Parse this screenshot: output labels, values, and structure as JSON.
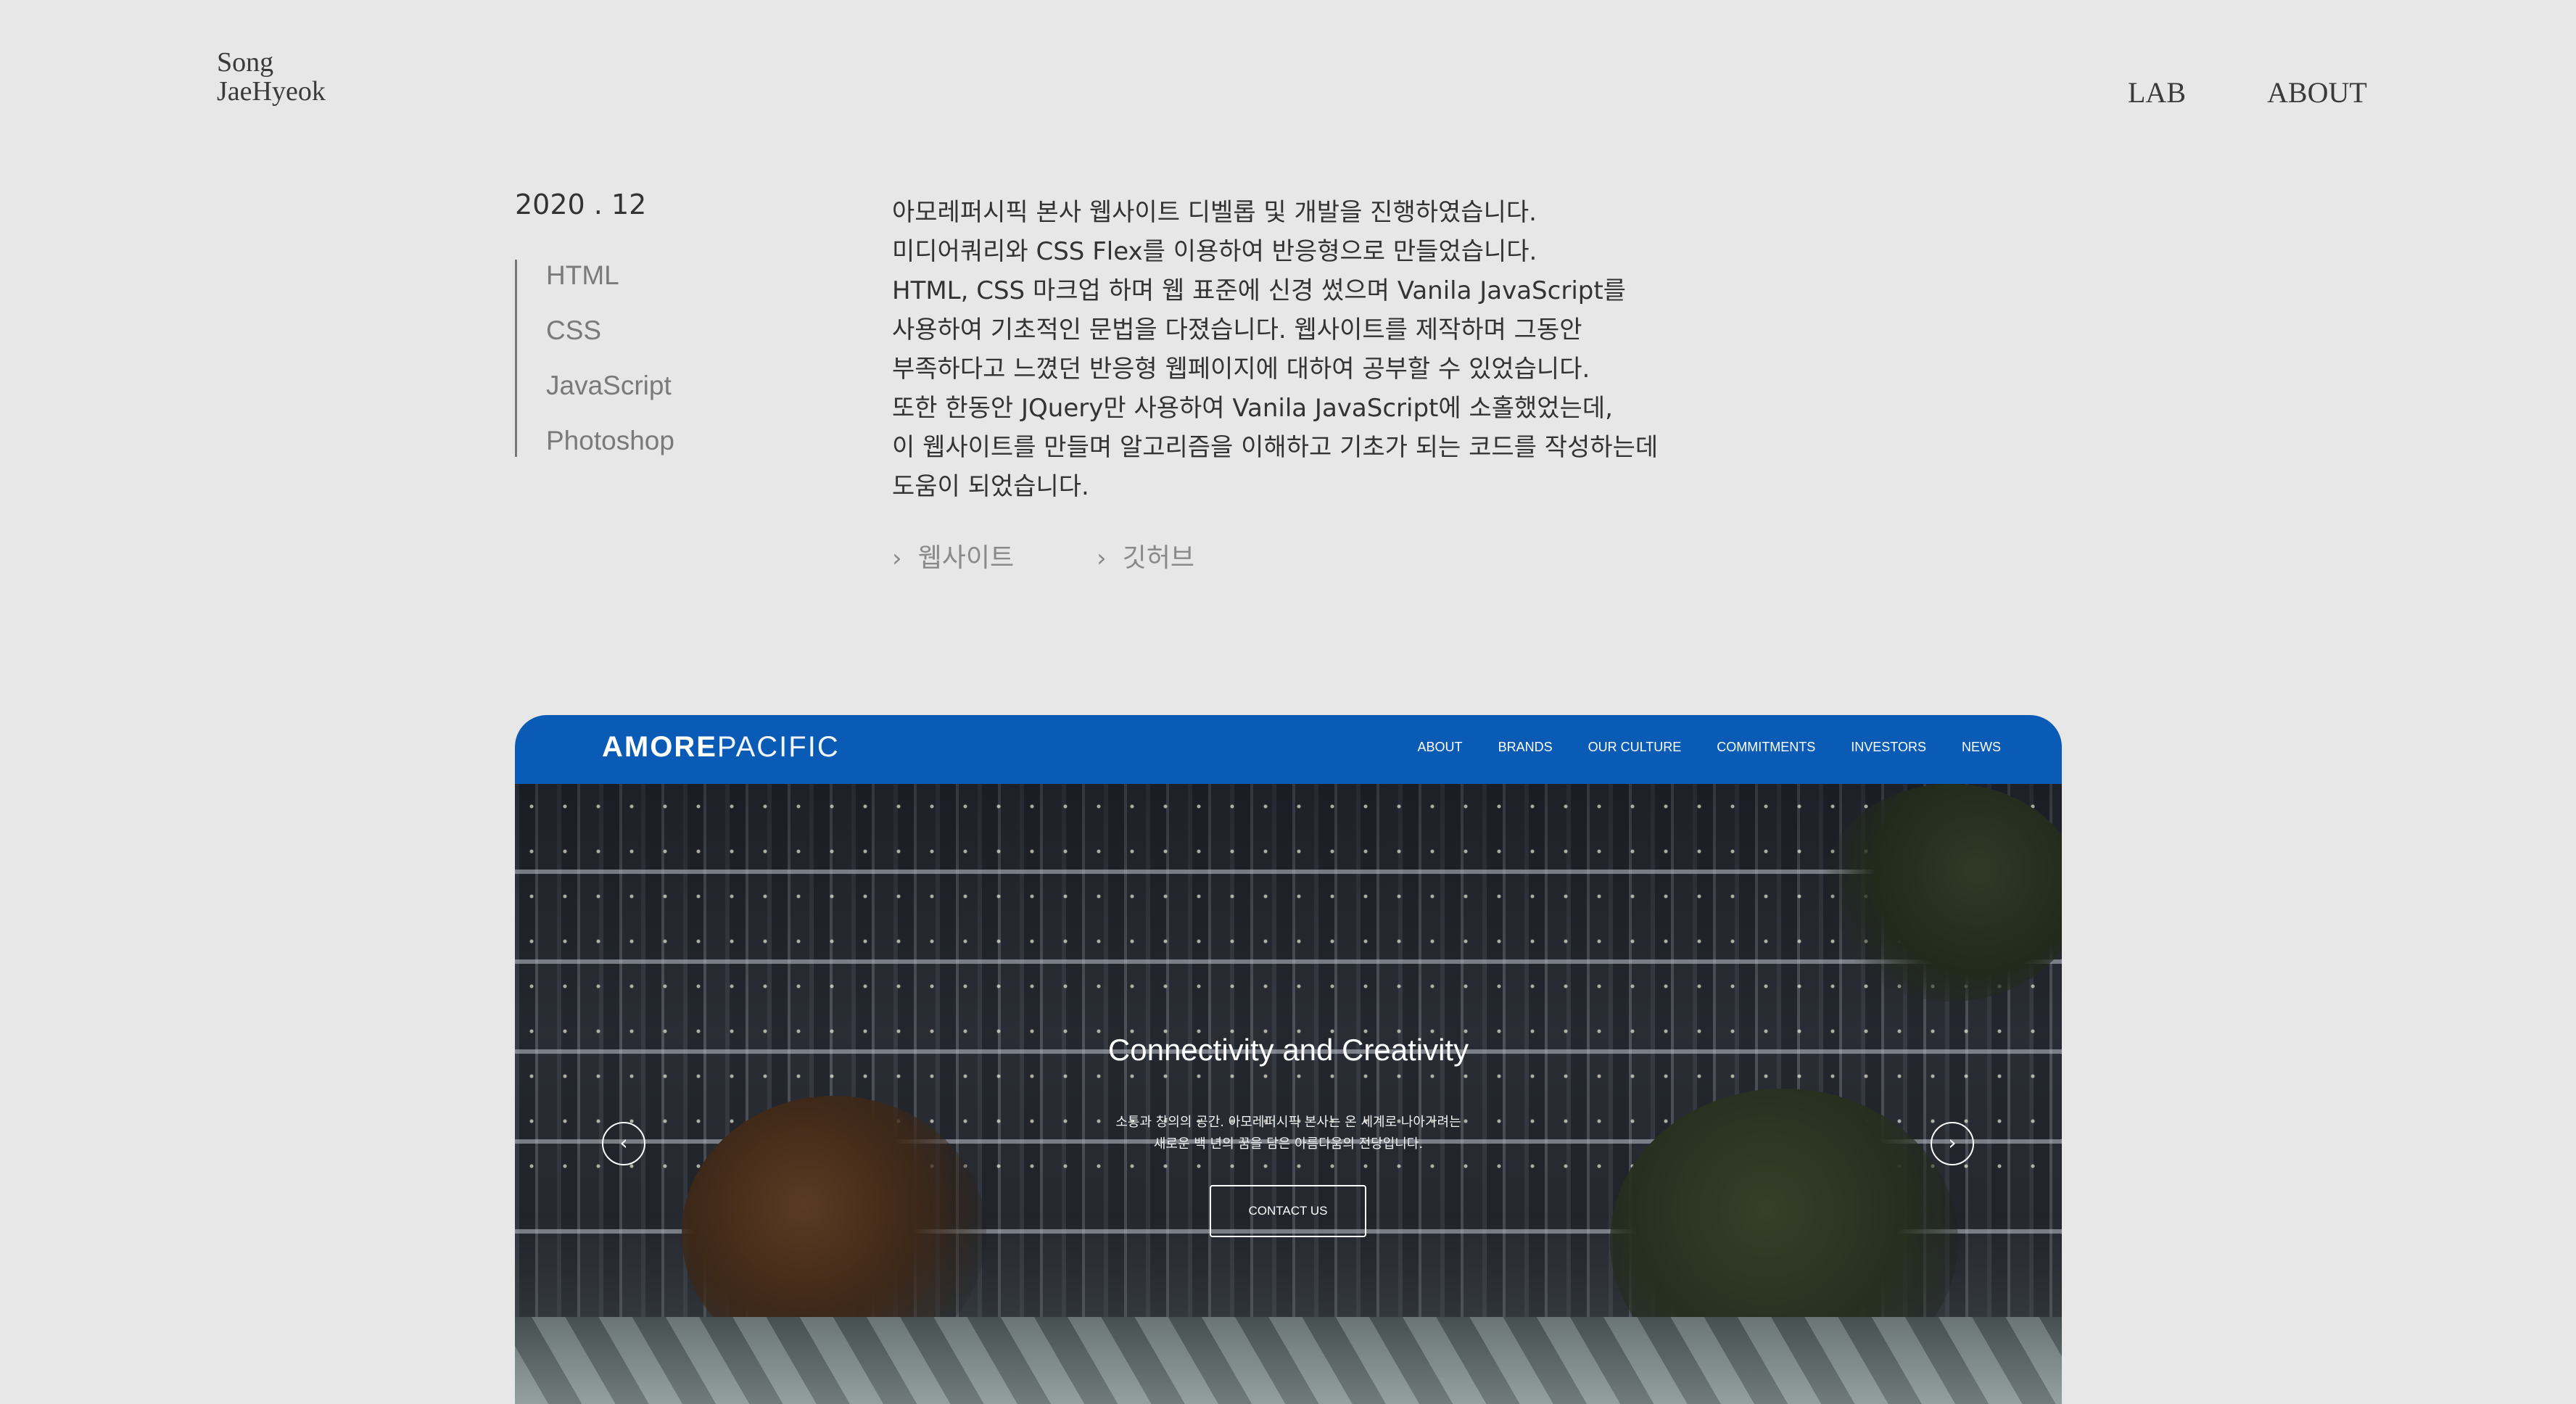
{
  "header": {
    "logo_line1": "Song",
    "logo_line2": "JaeHyeok",
    "nav": {
      "lab": "LAB",
      "about": "ABOUT"
    }
  },
  "project": {
    "date": "2020 . 12",
    "skills": [
      "HTML",
      "CSS",
      "JavaScript",
      "Photoshop"
    ],
    "description": [
      "아모레퍼시픽 본사 웹사이트 디벨롭 및 개발을 진행하였습니다.",
      "미디어쿼리와 CSS Flex를 이용하여 반응형으로 만들었습니다.",
      "HTML, CSS 마크업 하며 웹 표준에 신경 썼으며 Vanila JavaScript를",
      "사용하여 기초적인 문법을 다졌습니다. 웹사이트를 제작하며 그동안",
      "부족하다고 느꼈던 반응형 웹페이지에 대하여 공부할 수 있었습니다.",
      "또한 한동안 JQuery만 사용하여 Vanila JavaScript에 소홀했었는데,",
      "이 웹사이트를 만들며 알고리즘을 이해하고 기초가 되는 코드를 작성하는데",
      "도움이 되었습니다."
    ],
    "links": {
      "website": "웹사이트",
      "github": "깃허브",
      "chevron": "›"
    }
  },
  "preview": {
    "logo_bold": "AMORE",
    "logo_light": "PACIFIC",
    "menu": [
      "ABOUT",
      "BRANDS",
      "OUR CULTURE",
      "COMMITMENTS",
      "INVESTORS",
      "NEWS"
    ],
    "hero_title": "Connectivity and Creativity",
    "hero_sub_line1": "소통과 창의의 공간. 아모레퍼시픽 본사는 온 세계로 나아가려는",
    "hero_sub_line2": "새로운 백 년의 꿈을 담은 아름다움의 전당입니다.",
    "cta": "CONTACT US",
    "arrow_left": "‹",
    "arrow_right": "›",
    "accent_color": "#0a5bb5"
  }
}
